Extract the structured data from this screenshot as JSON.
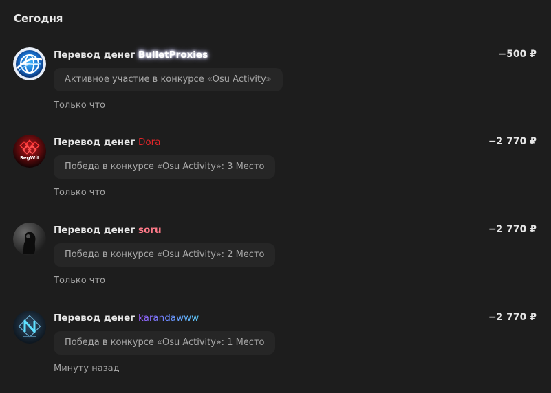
{
  "section": {
    "title": "Сегодня"
  },
  "colors": {
    "background": "#1d1d1d",
    "comment_bg": "#262626",
    "user_dora": "#e3262a",
    "user_soru": "#ff7a89"
  },
  "transactions": [
    {
      "title_prefix": "Перевод денег",
      "username": "BulletProxies",
      "amount": "−500 ₽",
      "comment": "Активное участие в конкурсе «Osu Activity»",
      "time": "Только что",
      "avatar_icon": "globe-logo-icon"
    },
    {
      "title_prefix": "Перевод денег",
      "username": "Dora",
      "amount": "−2 770 ₽",
      "comment": "Победа в конкурсе «Osu Activity»: 3 Место",
      "time": "Только что",
      "avatar_icon": "segwit-logo-icon",
      "avatar_text": "SegWit"
    },
    {
      "title_prefix": "Перевод денег",
      "username": "soru",
      "amount": "−2 770 ₽",
      "comment": "Победа в конкурсе «Osu Activity»: 2 Место",
      "time": "Только что",
      "avatar_icon": "dark-photo-avatar-icon"
    },
    {
      "title_prefix": "Перевод денег",
      "username": "karandawww",
      "amount": "−2 770 ₽",
      "comment": "Победа в конкурсе «Osu Activity»: 1 Место",
      "time": "Минуту назад",
      "avatar_icon": "n-logo-avatar-icon"
    }
  ]
}
